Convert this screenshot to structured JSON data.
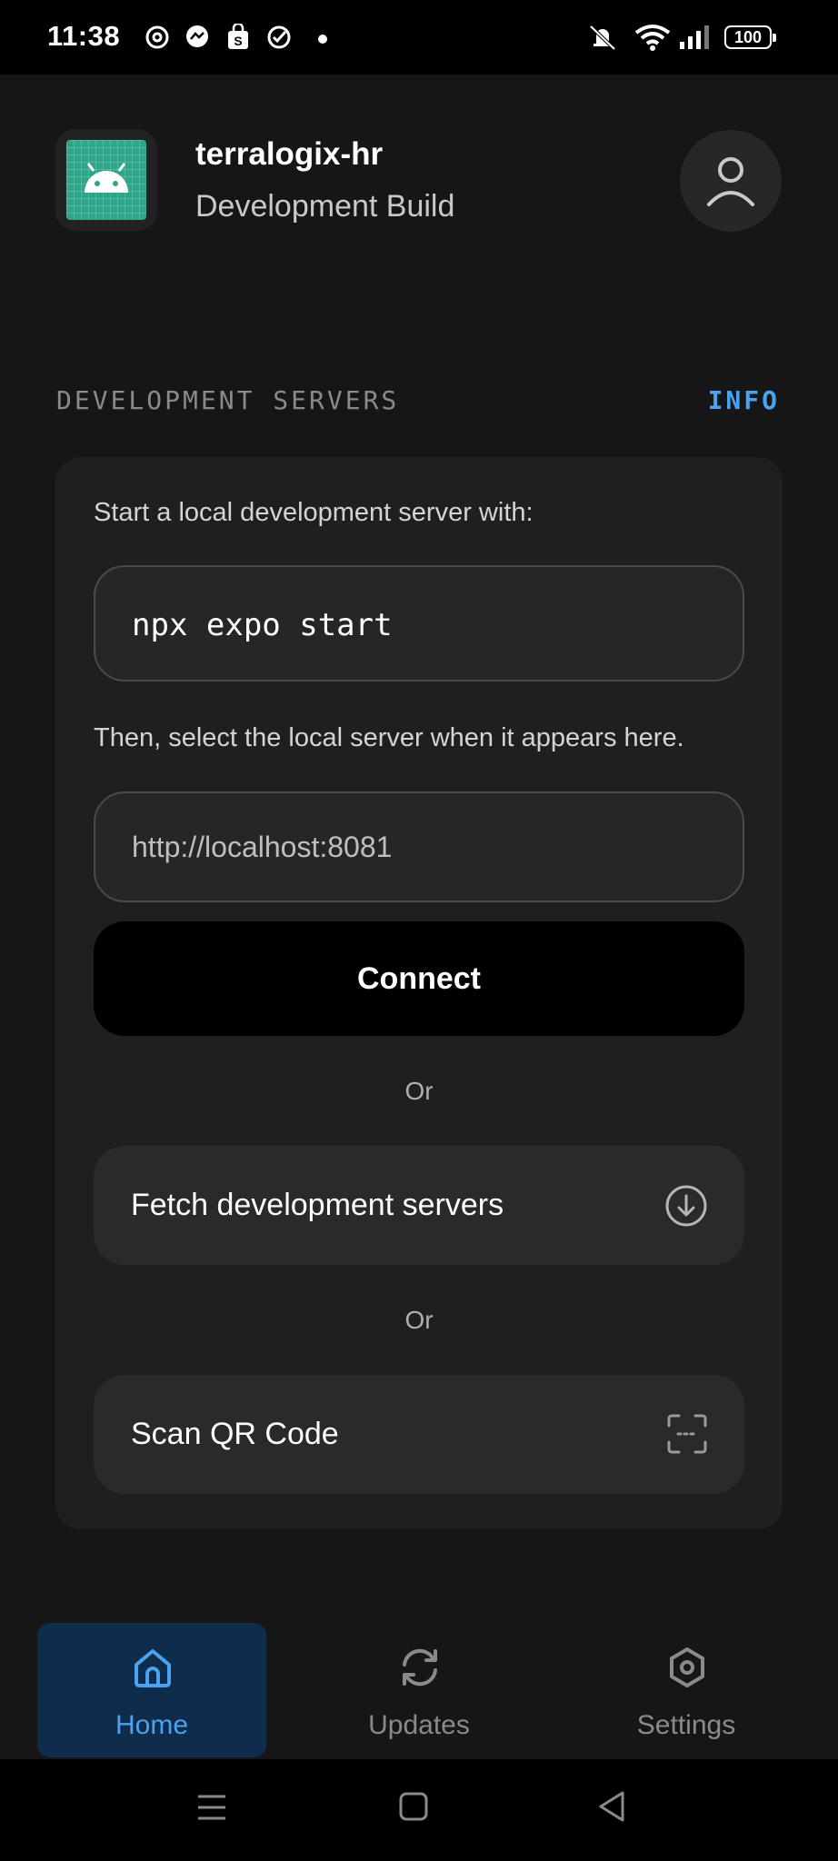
{
  "status_bar": {
    "time": "11:38",
    "battery": "100",
    "notification_icons": [
      "threads-icon",
      "messenger-icon",
      "shop-icon",
      "check-circle-icon",
      "dot-icon"
    ],
    "system_icons": [
      "mute-icon",
      "wifi-icon",
      "signal-icon",
      "battery-icon"
    ]
  },
  "header": {
    "app_name": "terralogix-hr",
    "subtitle": "Development Build",
    "app_icon": "android-icon",
    "profile_icon": "user-icon"
  },
  "section": {
    "title": "DEVELOPMENT SERVERS",
    "info_link": "INFO"
  },
  "card": {
    "intro_text": "Start a local development server with:",
    "command": "npx expo start",
    "then_text": "Then, select the local server when it appears here.",
    "url_placeholder": "http://localhost:8081",
    "connect_label": "Connect",
    "or_label_1": "Or",
    "fetch_label": "Fetch development servers",
    "fetch_icon": "download-circle-icon",
    "or_label_2": "Or",
    "scan_label": "Scan QR Code",
    "scan_icon": "qr-scan-icon"
  },
  "tabs": [
    {
      "label": "Home",
      "icon": "home-icon",
      "active": true
    },
    {
      "label": "Updates",
      "icon": "refresh-icon",
      "active": false
    },
    {
      "label": "Settings",
      "icon": "settings-icon",
      "active": false
    }
  ],
  "colors": {
    "background": "#161616",
    "card": "#1f1f1f",
    "accent": "#4aa3f0",
    "active_tab_bg": "#0f2c4c"
  }
}
